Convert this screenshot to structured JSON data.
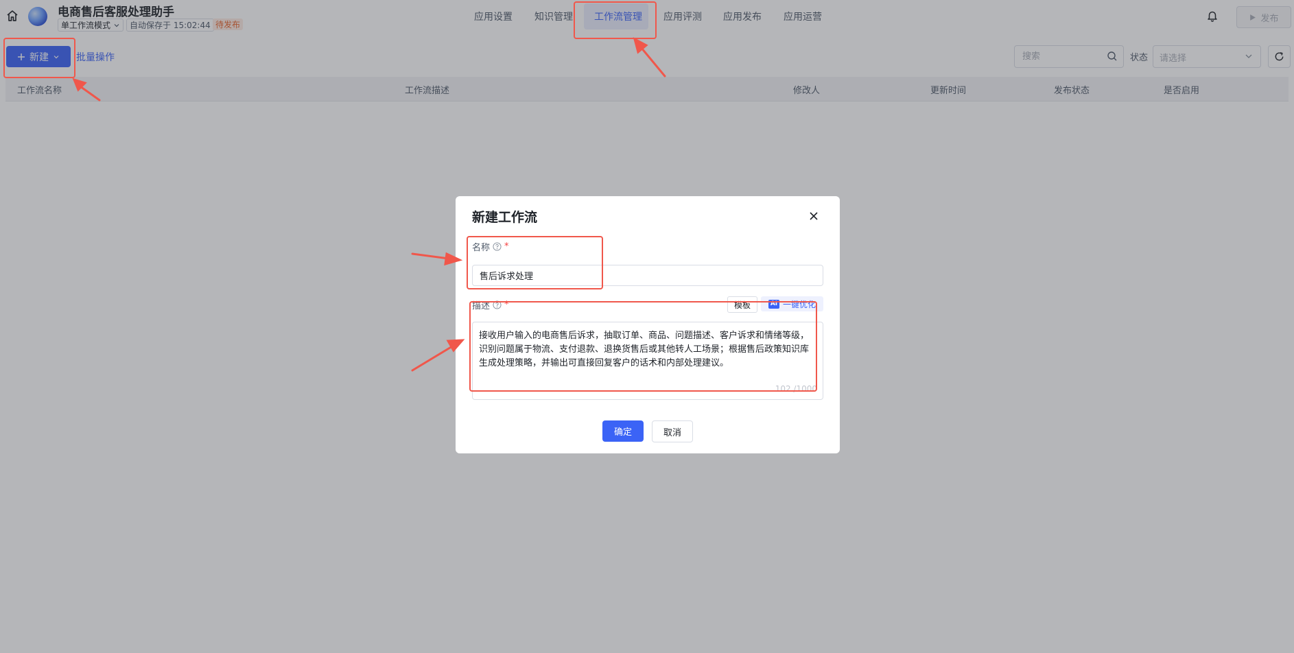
{
  "app": {
    "title": "电商售后客服处理助手",
    "mode": "单工作流模式",
    "autosave": "自动保存于 15:02:44",
    "status": "待发布"
  },
  "nav": {
    "items": [
      "应用设置",
      "知识管理",
      "工作流管理",
      "应用评测",
      "应用发布",
      "应用运营"
    ],
    "active": "工作流管理"
  },
  "header": {
    "publish_label": "发布"
  },
  "toolbar": {
    "new_label": "新建",
    "bulk_label": "批量操作",
    "search_placeholder": "搜索",
    "state_label": "状态",
    "state_placeholder": "请选择"
  },
  "table": {
    "columns": [
      "工作流名称",
      "工作流描述",
      "修改人",
      "更新时间",
      "发布状态",
      "是否启用"
    ]
  },
  "dialog": {
    "title": "新建工作流",
    "name_label": "名称",
    "name_value": "售后诉求处理",
    "desc_label": "描述",
    "template_label": "模板",
    "ai_badge": "AI",
    "optimize_label": "一键优化",
    "description": "接收用户输入的电商售后诉求，抽取订单、商品、问题描述、客户诉求和情绪等级，识别问题属于物流、支付退款、退换货售后或其他转人工场景；根据售后政策知识库生成处理策略，并输出可直接回复客户的话术和内部处理建议。",
    "counter": "102 /1000",
    "confirm_label": "确定",
    "cancel_label": "取消"
  },
  "colors": {
    "primary": "#3b63f6",
    "annotation": "#f0574b",
    "pending": "#e8632b"
  }
}
